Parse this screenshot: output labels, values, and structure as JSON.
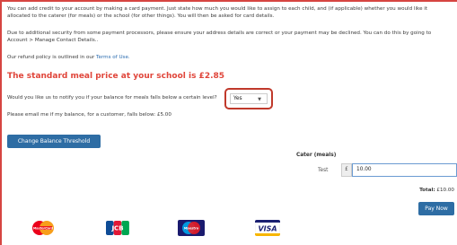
{
  "intro": {
    "line1": "You can add credit to your account by making a card payment. Just state how much you would like to assign to each child, and (if applicable) whether you would like it",
    "line2": "allocated to the caterer (for meals) or the school (for other things). You will then be asked for card details.",
    "security1": "Due to additional security from some payment processors, please ensure your address details are correct or your payment may be declined. You can do this by going to",
    "security2": "Account > Manage Contact Details..",
    "refund_prefix": "Our refund policy is outlined in our ",
    "refund_link": "Terms of Use."
  },
  "meal_price": "The standard meal price at your school is £2.85",
  "notify": {
    "label": "Would you like us to notify you if your balance for meals falls below a certain level?",
    "selected": "Yes"
  },
  "email_threshold": "Please email me if my balance, for a customer, falls below: £5.00",
  "buttons": {
    "change_threshold": "Change Balance Threshold",
    "pay_now": "Pay Now"
  },
  "payment": {
    "column_header": "Cater (meals)",
    "row_label": "Test",
    "currency_symbol": "£",
    "amount": "10.00",
    "total_label": "Total:",
    "total_value": "£10.00"
  },
  "cards": {
    "mastercard": "MasterCard",
    "jcb": "JCB",
    "maestro": "Maestro",
    "visa": "VISA"
  },
  "colors": {
    "accent_red": "#e0453a",
    "button_blue": "#2e6da4"
  }
}
